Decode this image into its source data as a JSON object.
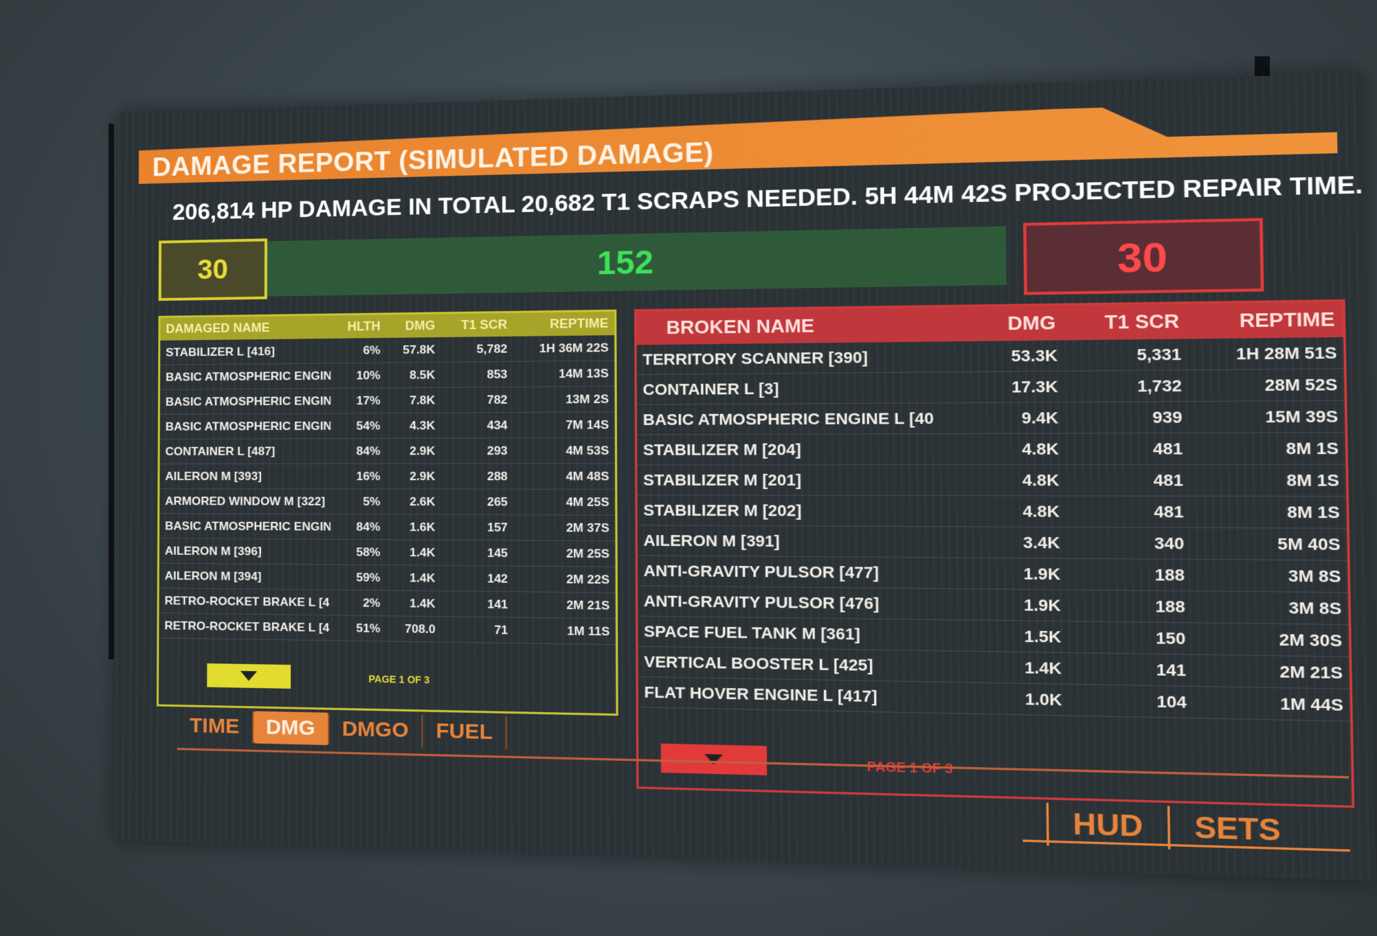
{
  "header": {
    "title": "DAMAGE REPORT (SIMULATED DAMAGE)",
    "summary": "206,814 HP DAMAGE IN TOTAL 20,682 T1 SCRAPS NEEDED. 5H 44M 42S PROJECTED REPAIR TIME."
  },
  "counters": {
    "damaged": "30",
    "healthy": "152",
    "broken": "30"
  },
  "damaged_table": {
    "headers": [
      "DAMAGED NAME",
      "HLTH",
      "DMG",
      "T1 SCR",
      "REPTIME"
    ],
    "rows": [
      [
        "STABILIZER L [416]",
        "6%",
        "57.8K",
        "5,782",
        "1H 36M 22S"
      ],
      [
        "BASIC ATMOSPHERIC ENGIN",
        "10%",
        "8.5K",
        "853",
        "14M 13S"
      ],
      [
        "BASIC ATMOSPHERIC ENGIN",
        "17%",
        "7.8K",
        "782",
        "13M 2S"
      ],
      [
        "BASIC ATMOSPHERIC ENGIN",
        "54%",
        "4.3K",
        "434",
        "7M 14S"
      ],
      [
        "CONTAINER L [487]",
        "84%",
        "2.9K",
        "293",
        "4M 53S"
      ],
      [
        "AILERON M [393]",
        "16%",
        "2.9K",
        "288",
        "4M 48S"
      ],
      [
        "ARMORED WINDOW M [322]",
        "5%",
        "2.6K",
        "265",
        "4M 25S"
      ],
      [
        "BASIC ATMOSPHERIC ENGIN",
        "84%",
        "1.6K",
        "157",
        "2M 37S"
      ],
      [
        "AILERON M [396]",
        "58%",
        "1.4K",
        "145",
        "2M 25S"
      ],
      [
        "AILERON M [394]",
        "59%",
        "1.4K",
        "142",
        "2M 22S"
      ],
      [
        "RETRO-ROCKET BRAKE L [4",
        "2%",
        "1.4K",
        "141",
        "2M 21S"
      ],
      [
        "RETRO-ROCKET BRAKE L [4",
        "51%",
        "708.0",
        "71",
        "1M 11S"
      ]
    ],
    "page_label": "PAGE 1 OF 3"
  },
  "broken_table": {
    "headers": [
      "BROKEN NAME",
      "DMG",
      "T1 SCR",
      "REPTIME"
    ],
    "rows": [
      [
        "TERRITORY SCANNER [390]",
        "53.3K",
        "5,331",
        "1H 28M 51S"
      ],
      [
        "CONTAINER L [3]",
        "17.3K",
        "1,732",
        "28M 52S"
      ],
      [
        "BASIC ATMOSPHERIC ENGINE L [40",
        "9.4K",
        "939",
        "15M 39S"
      ],
      [
        "STABILIZER M [204]",
        "4.8K",
        "481",
        "8M 1S"
      ],
      [
        "STABILIZER M [201]",
        "4.8K",
        "481",
        "8M 1S"
      ],
      [
        "STABILIZER M [202]",
        "4.8K",
        "481",
        "8M 1S"
      ],
      [
        "AILERON M [391]",
        "3.4K",
        "340",
        "5M 40S"
      ],
      [
        "ANTI-GRAVITY PULSOR [477]",
        "1.9K",
        "188",
        "3M 8S"
      ],
      [
        "ANTI-GRAVITY PULSOR [476]",
        "1.9K",
        "188",
        "3M 8S"
      ],
      [
        "SPACE FUEL TANK M [361]",
        "1.5K",
        "150",
        "2M 30S"
      ],
      [
        "VERTICAL BOOSTER L [425]",
        "1.4K",
        "141",
        "2M 21S"
      ],
      [
        "FLAT HOVER ENGINE L [417]",
        "1.0K",
        "104",
        "1M 44S"
      ]
    ],
    "page_label": "PAGE 1 OF 3"
  },
  "tabs": [
    {
      "label": "TIME",
      "active": false
    },
    {
      "label": "DMG",
      "active": true
    },
    {
      "label": "DMGO",
      "active": false
    },
    {
      "label": "FUEL",
      "active": false
    }
  ],
  "side_buttons": {
    "hud": "HUD",
    "sets": "SETS"
  },
  "icons": {
    "page_down_left": "triangle-down-icon",
    "page_down_right": "triangle-down-icon"
  },
  "colors": {
    "accent_orange": "#e8843a",
    "damaged_yellow": "#d8d030",
    "healthy_green": "#3fe05a",
    "broken_red": "#e03a3a"
  }
}
